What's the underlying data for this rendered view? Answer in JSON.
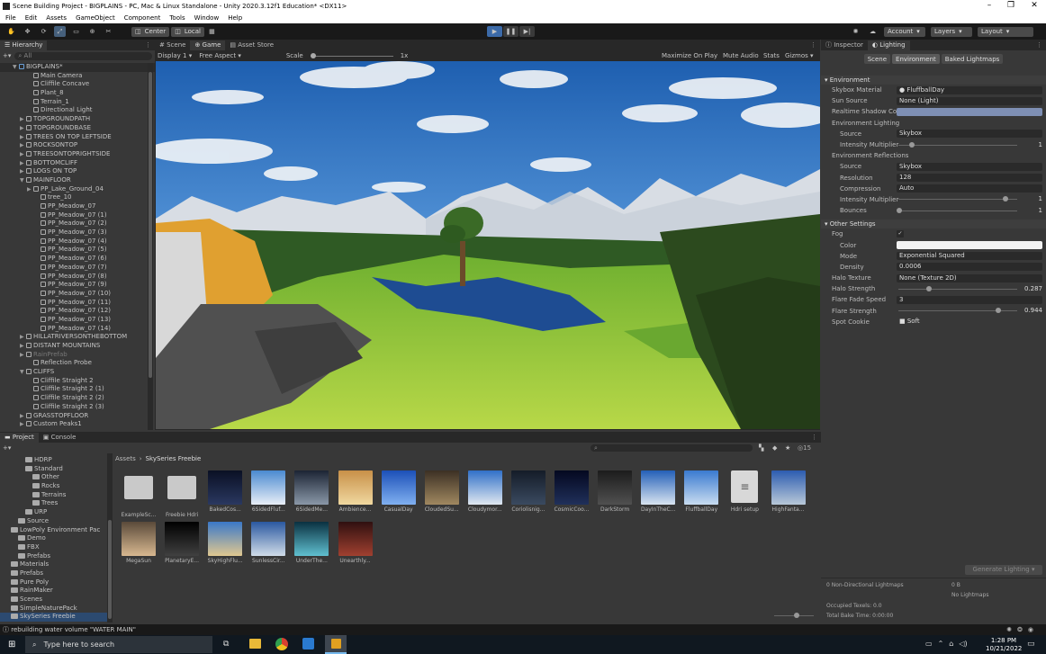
{
  "window": {
    "title": "Scene Building Project - BIGPLAINS - PC, Mac & Linux Standalone - Unity 2020.3.12f1 Education* <DX11>"
  },
  "menu": [
    "File",
    "Edit",
    "Assets",
    "GameObject",
    "Component",
    "Tools",
    "Window",
    "Help"
  ],
  "toolbar": {
    "center": "Center",
    "local": "Local",
    "account": "Account",
    "layers": "Layers",
    "layout": "Layout"
  },
  "hierarchy": {
    "tab": "Hierarchy",
    "search": "All",
    "items": [
      {
        "label": "BIGPLAINS*",
        "indent": 0,
        "kind": "scene"
      },
      {
        "label": "Main Camera",
        "indent": 2,
        "kind": "obj"
      },
      {
        "label": "Cliffile Concave",
        "indent": 2,
        "kind": "obj"
      },
      {
        "label": "Plant_8",
        "indent": 2,
        "kind": "obj"
      },
      {
        "label": "Terrain_1",
        "indent": 2,
        "kind": "obj"
      },
      {
        "label": "Directional Light",
        "indent": 2,
        "kind": "obj"
      },
      {
        "label": "TOPGROUNDPATH",
        "indent": 1,
        "kind": "grp"
      },
      {
        "label": "TOPGROUNDBASE",
        "indent": 1,
        "kind": "grp"
      },
      {
        "label": "TREES ON TOP LEFTSIDE",
        "indent": 1,
        "kind": "grp"
      },
      {
        "label": "ROCKSONTOP",
        "indent": 1,
        "kind": "grp"
      },
      {
        "label": "TREESONTOPRIGHTSIDE",
        "indent": 1,
        "kind": "grp"
      },
      {
        "label": "BOTTOMCLIFF",
        "indent": 1,
        "kind": "grp"
      },
      {
        "label": "LOGS ON TOP",
        "indent": 1,
        "kind": "grp"
      },
      {
        "label": "MAINFLOOR",
        "indent": 1,
        "kind": "open"
      },
      {
        "label": "PP_Lake_Ground_04",
        "indent": 2,
        "kind": "grp"
      },
      {
        "label": "tree_10",
        "indent": 3,
        "kind": "obj"
      },
      {
        "label": "PP_Meadow_07",
        "indent": 3,
        "kind": "obj"
      },
      {
        "label": "PP_Meadow_07 (1)",
        "indent": 3,
        "kind": "obj"
      },
      {
        "label": "PP_Meadow_07 (2)",
        "indent": 3,
        "kind": "obj"
      },
      {
        "label": "PP_Meadow_07 (3)",
        "indent": 3,
        "kind": "obj"
      },
      {
        "label": "PP_Meadow_07 (4)",
        "indent": 3,
        "kind": "obj"
      },
      {
        "label": "PP_Meadow_07 (5)",
        "indent": 3,
        "kind": "obj"
      },
      {
        "label": "PP_Meadow_07 (6)",
        "indent": 3,
        "kind": "obj"
      },
      {
        "label": "PP_Meadow_07 (7)",
        "indent": 3,
        "kind": "obj"
      },
      {
        "label": "PP_Meadow_07 (8)",
        "indent": 3,
        "kind": "obj"
      },
      {
        "label": "PP_Meadow_07 (9)",
        "indent": 3,
        "kind": "obj"
      },
      {
        "label": "PP_Meadow_07 (10)",
        "indent": 3,
        "kind": "obj"
      },
      {
        "label": "PP_Meadow_07 (11)",
        "indent": 3,
        "kind": "obj"
      },
      {
        "label": "PP_Meadow_07 (12)",
        "indent": 3,
        "kind": "obj"
      },
      {
        "label": "PP_Meadow_07 (13)",
        "indent": 3,
        "kind": "obj"
      },
      {
        "label": "PP_Meadow_07 (14)",
        "indent": 3,
        "kind": "obj"
      },
      {
        "label": "HILLATRIVERSONTHEBOTTOM",
        "indent": 1,
        "kind": "grp"
      },
      {
        "label": "DISTANT MOUNTAINS",
        "indent": 1,
        "kind": "grp"
      },
      {
        "label": "RainPrefab",
        "indent": 1,
        "kind": "dim"
      },
      {
        "label": "Reflection Probe",
        "indent": 2,
        "kind": "obj"
      },
      {
        "label": "CLIFFS",
        "indent": 1,
        "kind": "open"
      },
      {
        "label": "Cliffile Straight 2",
        "indent": 2,
        "kind": "obj"
      },
      {
        "label": "Cliffile Straight 2 (1)",
        "indent": 2,
        "kind": "obj"
      },
      {
        "label": "Cliffile Straight 2 (2)",
        "indent": 2,
        "kind": "obj"
      },
      {
        "label": "Cliffile Straight 2 (3)",
        "indent": 2,
        "kind": "obj"
      },
      {
        "label": "GRASSTOPFLOOR",
        "indent": 1,
        "kind": "grp"
      },
      {
        "label": "Custom Peaks1",
        "indent": 1,
        "kind": "grp"
      }
    ]
  },
  "scene_tabs": {
    "scene": "Scene",
    "game": "Game",
    "asset_store": "Asset Store"
  },
  "game_bar": {
    "display": "Display 1",
    "aspect": "Free Aspect",
    "scale_label": "Scale",
    "scale_value": "1x",
    "maximize": "Maximize On Play",
    "mute": "Mute Audio",
    "stats": "Stats",
    "gizmos": "Gizmos"
  },
  "inspector": {
    "tab_inspector": "Inspector",
    "tab_lighting": "Lighting",
    "subtabs": [
      "Scene",
      "Environment",
      "Baked Lightmaps"
    ],
    "environment": {
      "header": "Environment",
      "skybox_label": "Skybox Material",
      "skybox": "FluffballDay",
      "sun_label": "Sun Source",
      "sun": "None (Light)",
      "shadow_label": "Realtime Shadow Color",
      "env_lighting": "Environment Lighting",
      "source_label": "Source",
      "source": "Skybox",
      "intensity_label": "Intensity Multiplier",
      "intensity": "1",
      "env_reflections": "Environment Reflections",
      "r_source": "Skybox",
      "res_label": "Resolution",
      "resolution": "128",
      "comp_label": "Compression",
      "compression": "Auto",
      "r_intensity": "1",
      "bounces_label": "Bounces",
      "bounces": "1"
    },
    "other": {
      "header": "Other Settings",
      "fog_label": "Fog",
      "color_label": "Color",
      "mode_label": "Mode",
      "mode": "Exponential Squared",
      "density_label": "Density",
      "density": "0.0006",
      "halo_tex_label": "Halo Texture",
      "halo_tex": "None (Texture 2D)",
      "halo_str_label": "Halo Strength",
      "halo_str": "0.287",
      "flare_fade_label": "Flare Fade Speed",
      "flare_fade": "3",
      "flare_str_label": "Flare Strength",
      "flare_str": "0.944",
      "spot_label": "Spot Cookie",
      "spot": "Soft"
    },
    "generate": "Generate Lighting",
    "stats": {
      "nondir": "0 Non-Directional Lightmaps",
      "nondir_val": "0 B",
      "no_lightmaps": "No Lightmaps",
      "occupied": "Occupied Texels: 0.0",
      "bake_time": "Total Bake Time: 0:00:00"
    }
  },
  "project": {
    "tab_project": "Project",
    "tab_console": "Console",
    "count": "15",
    "breadcrumb": [
      "Assets",
      "SkySeries Freebie"
    ],
    "tree": [
      {
        "label": "HDRP",
        "indent": 3
      },
      {
        "label": "Standard",
        "indent": 3
      },
      {
        "label": "Other",
        "indent": 4
      },
      {
        "label": "Rocks",
        "indent": 4
      },
      {
        "label": "Terrains",
        "indent": 4
      },
      {
        "label": "Trees",
        "indent": 4
      },
      {
        "label": "URP",
        "indent": 3
      },
      {
        "label": "Source",
        "indent": 2
      },
      {
        "label": "LowPoly Environment Pac",
        "indent": 1
      },
      {
        "label": "Demo",
        "indent": 2
      },
      {
        "label": "FBX",
        "indent": 2
      },
      {
        "label": "Prefabs",
        "indent": 2
      },
      {
        "label": "Materials",
        "indent": 1
      },
      {
        "label": "Prefabs",
        "indent": 1
      },
      {
        "label": "Pure Poly",
        "indent": 1
      },
      {
        "label": "RainMaker",
        "indent": 1
      },
      {
        "label": "Scenes",
        "indent": 1
      },
      {
        "label": "SimpleNaturePack",
        "indent": 1
      },
      {
        "label": "SkySeries Freebie",
        "indent": 1
      }
    ],
    "assets": [
      {
        "name": "ExampleSc...",
        "c1": "#c9c9c9",
        "c2": "#c9c9c9",
        "folder": true
      },
      {
        "name": "Freebie Hdri",
        "c1": "#c9c9c9",
        "c2": "#c9c9c9",
        "folder": true
      },
      {
        "name": "BakedCos...",
        "c1": "#0a1024",
        "c2": "#2a3860"
      },
      {
        "name": "6SidedFluf...",
        "c1": "#4a8ad0",
        "c2": "#e8eef6"
      },
      {
        "name": "6SidedMe...",
        "c1": "#1c2434",
        "c2": "#8a98a8"
      },
      {
        "name": "Ambience...",
        "c1": "#c89048",
        "c2": "#f0d8a0"
      },
      {
        "name": "CasualDay",
        "c1": "#1c50b8",
        "c2": "#80b0f0"
      },
      {
        "name": "CloudedSu...",
        "c1": "#3c3024",
        "c2": "#a08860"
      },
      {
        "name": "Cloudymor...",
        "c1": "#3070c8",
        "c2": "#e0e8f0"
      },
      {
        "name": "Coriolisnig...",
        "c1": "#141c28",
        "c2": "#3a4a60"
      },
      {
        "name": "CosmicCoo...",
        "c1": "#040820",
        "c2": "#20305a"
      },
      {
        "name": "DarkStorm",
        "c1": "#1c1c1c",
        "c2": "#505050"
      },
      {
        "name": "DayInTheC...",
        "c1": "#2460b8",
        "c2": "#d8e4f0"
      },
      {
        "name": "FluffballDay",
        "c1": "#3a7ad0",
        "c2": "#c8dcf0"
      },
      {
        "name": "Hdri setup",
        "c1": "#d8d8d8",
        "c2": "#d8d8d8",
        "doc": true
      },
      {
        "name": "HighFanta...",
        "c1": "#2c5cb0",
        "c2": "#b8c8d8"
      },
      {
        "name": "MegaSun",
        "c1": "#5a4a3a",
        "c2": "#d8b890"
      },
      {
        "name": "PlanetaryE...",
        "c1": "#000000",
        "c2": "#404040"
      },
      {
        "name": "SkyHighFlu...",
        "c1": "#3a78c8",
        "c2": "#e0c890"
      },
      {
        "name": "SunlessCir...",
        "c1": "#2a58a0",
        "c2": "#d0dce8"
      },
      {
        "name": "UnderThe...",
        "c1": "#0a3040",
        "c2": "#60c0d0"
      },
      {
        "name": "Unearthly...",
        "c1": "#301010",
        "c2": "#a04030"
      }
    ]
  },
  "status": {
    "text": "rebuilding water volume \"WATER MAIN\""
  },
  "taskbar": {
    "search": "Type here to search",
    "time": "1:28 PM",
    "date": "10/21/2022"
  }
}
